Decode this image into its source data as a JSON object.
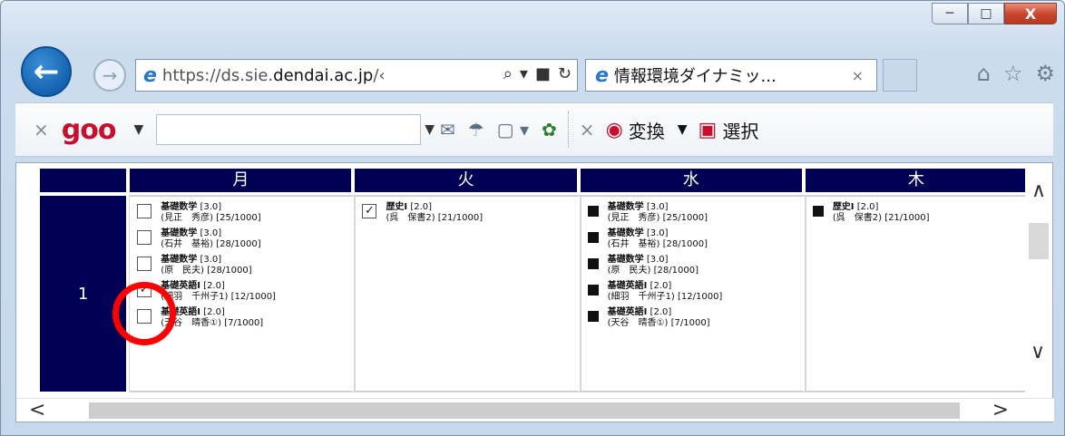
{
  "window": {
    "minimize": "─",
    "maximize": "□",
    "close": "X"
  },
  "nav": {
    "back_icon": "←",
    "forward_icon": "→",
    "address_prefix": "https://ds.sie.",
    "address_domain": "dendai.ac.jp",
    "address_suffix": "/‹",
    "search_icon": "⌕",
    "lock_icon": "🔒",
    "refresh_icon": "↻",
    "tab_title": "情報環境ダイナミッ...",
    "tab_close": "×",
    "icons": [
      "home-icon",
      "star-icon",
      "gear-icon"
    ]
  },
  "toolbar": {
    "close": "×",
    "logo": "goo",
    "convert_label": "変換",
    "select_label": "選択",
    "close2": "×"
  },
  "timetable": {
    "headers": [
      "",
      "月",
      "火",
      "水",
      "木"
    ],
    "period": "1",
    "mon": [
      {
        "checked": false,
        "name": "基礎数学",
        "credit": "[3.0]",
        "teacher": "(見正　秀彦)",
        "count": "[25/1000]"
      },
      {
        "checked": false,
        "name": "基礎数学",
        "credit": "[3.0]",
        "teacher": "(石井　基裕)",
        "count": "[28/1000]"
      },
      {
        "checked": false,
        "name": "基礎数学",
        "credit": "[3.0]",
        "teacher": "(原　民夫)",
        "count": "[28/1000]"
      },
      {
        "checked": true,
        "name": "基礎英語Ⅰ",
        "credit": "[2.0]",
        "teacher": "(細羽　千州子1)",
        "count": "[12/1000]"
      },
      {
        "checked": false,
        "name": "基礎英語Ⅰ",
        "credit": "[2.0]",
        "teacher": "(天谷　晴香①)",
        "count": "[7/1000]"
      }
    ],
    "tue": [
      {
        "checked": true,
        "name": "歴史Ⅰ",
        "credit": "[2.0]",
        "teacher": "(呉　保書2)",
        "count": "[21/1000]"
      }
    ],
    "wed": [
      {
        "name": "基礎数学",
        "credit": "[3.0]",
        "teacher": "(見正　秀彦)",
        "count": "[25/1000]"
      },
      {
        "name": "基礎数学",
        "credit": "[3.0]",
        "teacher": "(石井　基裕)",
        "count": "[28/1000]"
      },
      {
        "name": "基礎数学",
        "credit": "[3.0]",
        "teacher": "(原　民夫)",
        "count": "[28/1000]"
      },
      {
        "name": "基礎英語Ⅰ",
        "credit": "[2.0]",
        "teacher": "(細羽　千州子1)",
        "count": "[12/1000]"
      },
      {
        "name": "基礎英語Ⅰ",
        "credit": "[2.0]",
        "teacher": "(天谷　晴香①)",
        "count": "[7/1000]"
      }
    ],
    "thu": [
      {
        "name": "歴史Ⅰ",
        "credit": "[2.0]",
        "teacher": "(呉　保書2)",
        "count": "[21/1000]"
      }
    ]
  },
  "scroll": {
    "up": "∧",
    "down": "∨",
    "left": "<",
    "right": ">"
  },
  "colors": {
    "header_bg": "#000054",
    "highlight": "#ff0000"
  }
}
